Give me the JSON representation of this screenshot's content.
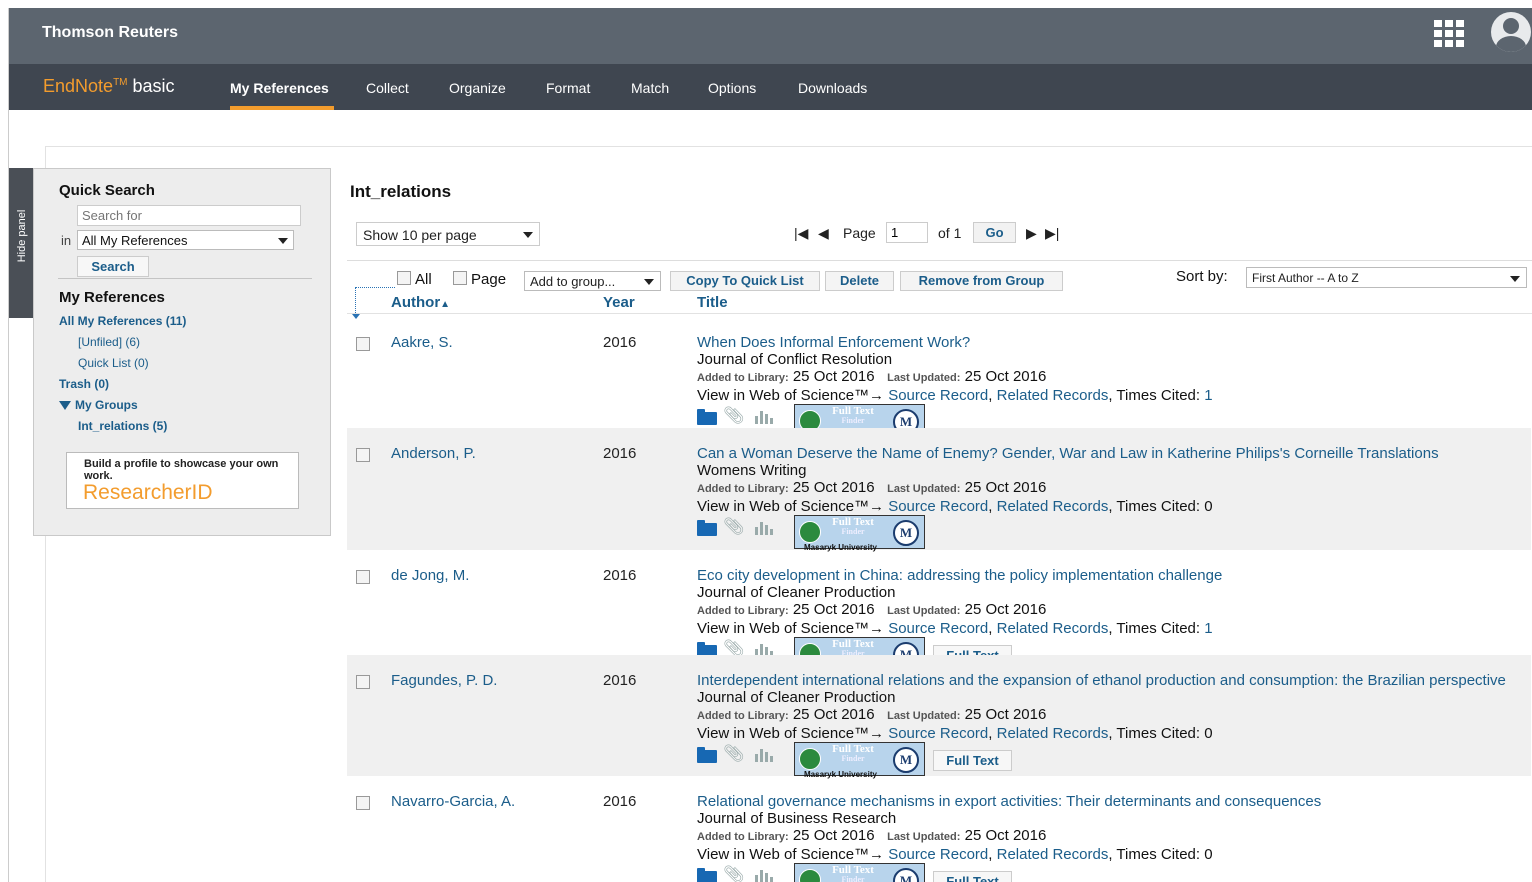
{
  "header": {
    "brand": "Thomson Reuters",
    "apps_icon": "grid-apps-icon",
    "avatar_icon": "user-avatar-icon"
  },
  "nav": {
    "logo_prefix": "EndNote",
    "logo_tm": "TM",
    "logo_suffix": "basic",
    "items": [
      "My References",
      "Collect",
      "Organize",
      "Format",
      "Match",
      "Options",
      "Downloads"
    ],
    "active": "My References",
    "accent_color": "#f39c2d"
  },
  "panel_toggle": "Hide panel",
  "sidebar": {
    "quick_search_title": "Quick Search",
    "search_placeholder": "Search for",
    "in_label": "in",
    "scope_value": "All My References",
    "search_button": "Search",
    "my_references_title": "My References",
    "links": {
      "all": "All My References (11)",
      "unfiled": "[Unfiled] (6)",
      "quick_list": "Quick List (0)",
      "trash": "Trash (0)",
      "my_groups": "My Groups",
      "group_int": "Int_relations (5)"
    },
    "researcher_promo": "Build a profile to showcase your own work.",
    "researcher_logo": "ResearcherID"
  },
  "main": {
    "folder_title": "Int_relations",
    "per_page": "Show 10 per page",
    "pager": {
      "page_label": "Page",
      "page_value": "1",
      "of_label": "of 1",
      "go": "Go"
    },
    "toolbar": {
      "all_label": "All",
      "page_label": "Page",
      "add_to_group": "Add to group...",
      "copy_quick": "Copy To Quick List",
      "delete": "Delete",
      "remove_group": "Remove from Group",
      "sort_label": "Sort by:",
      "sort_value": "First Author -- A to Z"
    },
    "columns": {
      "author": "Author",
      "year": "Year",
      "title": "Title"
    },
    "row_labels": {
      "added": "Added to Library:",
      "updated": "Last Updated:",
      "view_wos": "View in Web of Science™→",
      "source_record": "Source Record",
      "related_records": "Related Records",
      "times_cited": "Times Cited:",
      "ff_full": "Full Text",
      "ff_finder": "Finder",
      "ff_uni": "Masaryk University",
      "ff_seal": "M",
      "full_text_btn": "Full Text"
    },
    "references": [
      {
        "author": "Aakre, S.",
        "year": "2016",
        "title": "When Does Informal Enforcement Work?",
        "journal": "Journal of Conflict Resolution",
        "added": "25 Oct 2016",
        "updated": "25 Oct 2016",
        "cited": "1",
        "cited_link": true,
        "full_text": false
      },
      {
        "author": "Anderson, P.",
        "year": "2016",
        "title": "Can a Woman Deserve the Name of Enemy? Gender, War and Law in Katherine Philips's Corneille Translations",
        "journal": "Womens Writing",
        "added": "25 Oct 2016",
        "updated": "25 Oct 2016",
        "cited": "0",
        "cited_link": false,
        "full_text": false
      },
      {
        "author": "de Jong, M.",
        "year": "2016",
        "title": "Eco city development in China: addressing the policy implementation challenge",
        "journal": "Journal of Cleaner Production",
        "added": "25 Oct 2016",
        "updated": "25 Oct 2016",
        "cited": "1",
        "cited_link": true,
        "full_text": true
      },
      {
        "author": "Fagundes, P. D.",
        "year": "2016",
        "title": "Interdependent international relations and the expansion of ethanol production and consumption: the Brazilian perspective",
        "journal": "Journal of Cleaner Production",
        "added": "25 Oct 2016",
        "updated": "25 Oct 2016",
        "cited": "0",
        "cited_link": false,
        "full_text": true
      },
      {
        "author": "Navarro-Garcia, A.",
        "year": "2016",
        "title": "Relational governance mechanisms in export activities: Their determinants and consequences",
        "journal": "Journal of Business Research",
        "added": "25 Oct 2016",
        "updated": "25 Oct 2016",
        "cited": "0",
        "cited_link": false,
        "full_text": true
      }
    ]
  }
}
